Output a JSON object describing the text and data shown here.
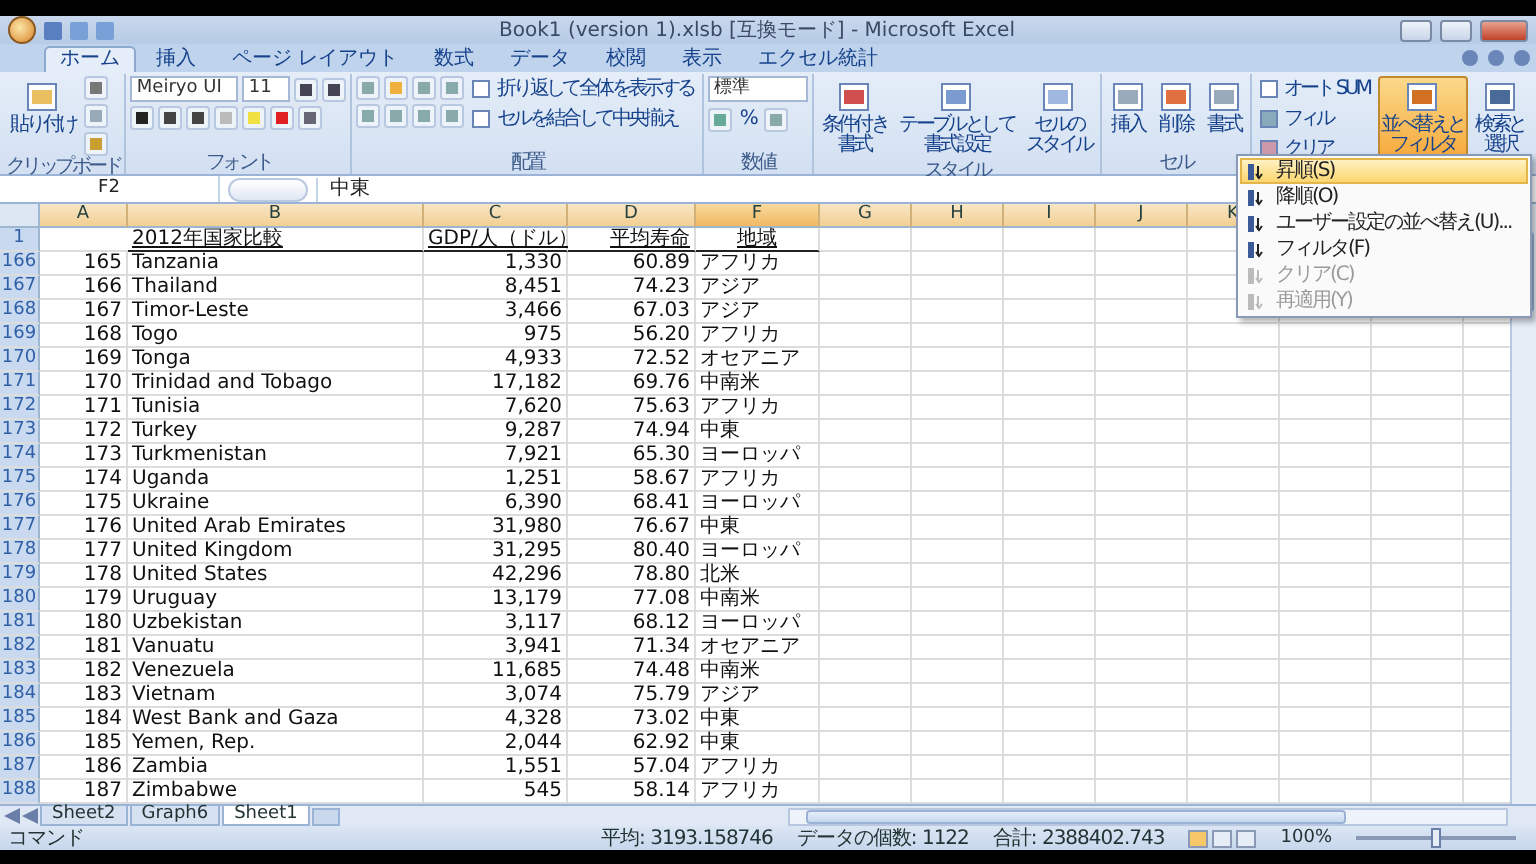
{
  "window": {
    "title": "Book1 (version 1).xlsb [互換モード] - Microsoft Excel"
  },
  "tabs": [
    {
      "label": "ホーム",
      "selected": true
    },
    {
      "label": "挿入",
      "selected": false
    },
    {
      "label": "ページ レイアウト",
      "selected": false
    },
    {
      "label": "数式",
      "selected": false
    },
    {
      "label": "データ",
      "selected": false
    },
    {
      "label": "校閲",
      "selected": false
    },
    {
      "label": "表示",
      "selected": false
    },
    {
      "label": "エクセル統計",
      "selected": false
    }
  ],
  "clipboard": {
    "label": "クリップボード",
    "paste": "貼り付け"
  },
  "font": {
    "label": "フォント",
    "name": "Meiryo UI",
    "size": "11"
  },
  "alignment": {
    "label": "配置",
    "wrap": "折り返して全体を表示する",
    "merge": "セルを結合して中央揃え"
  },
  "number": {
    "label": "数値",
    "format": "標準",
    "percent": "%"
  },
  "styles": {
    "label": "スタイル",
    "buttons": [
      [
        "条件付き",
        "書式"
      ],
      [
        "テーブルとして",
        "書式設定"
      ],
      [
        "セルの",
        "スタイル"
      ]
    ]
  },
  "cells": {
    "label": "セル",
    "buttons": [
      "挿入",
      "削除",
      "書式"
    ]
  },
  "editing": {
    "autosum": "オート SUM",
    "fill": "フィル",
    "clear": "クリア",
    "sort": {
      "lines": [
        "並べ替えと",
        "フィルタ"
      ],
      "pressed": true
    },
    "find": [
      "検索と",
      "選択"
    ]
  },
  "sort_menu": [
    {
      "label": "昇順(S)",
      "selected": true,
      "disabled": false
    },
    {
      "label": "降順(O)",
      "selected": false,
      "disabled": false
    },
    {
      "label": "ユーザー設定の並べ替え(U)...",
      "selected": false,
      "disabled": false
    },
    {
      "label": "フィルタ(F)",
      "selected": false,
      "disabled": false
    },
    {
      "label": "クリア(C)",
      "selected": false,
      "disabled": true
    },
    {
      "label": "再適用(Y)",
      "selected": false,
      "disabled": true
    }
  ],
  "formula_bar": {
    "name_box": "F2",
    "value": "中東"
  },
  "columns": [
    "A",
    "B",
    "C",
    "D",
    "F",
    "G",
    "H",
    "I",
    "J",
    "K"
  ],
  "header_row": {
    "row": "1",
    "b": "2012年国家比較",
    "c": "GDP/人（ドル）",
    "d": "平均寿命",
    "f": "地域"
  },
  "rows": [
    {
      "row": "166",
      "a": "165",
      "b": "Tanzania",
      "c": "1,330",
      "d": "60.89",
      "f": "アフリカ"
    },
    {
      "row": "167",
      "a": "166",
      "b": "Thailand",
      "c": "8,451",
      "d": "74.23",
      "f": "アジア"
    },
    {
      "row": "168",
      "a": "167",
      "b": "Timor-Leste",
      "c": "3,466",
      "d": "67.03",
      "f": "アジア"
    },
    {
      "row": "169",
      "a": "168",
      "b": "Togo",
      "c": "975",
      "d": "56.20",
      "f": "アフリカ"
    },
    {
      "row": "170",
      "a": "169",
      "b": "Tonga",
      "c": "4,933",
      "d": "72.52",
      "f": "オセアニア"
    },
    {
      "row": "171",
      "a": "170",
      "b": "Trinidad and Tobago",
      "c": "17,182",
      "d": "69.76",
      "f": "中南米"
    },
    {
      "row": "172",
      "a": "171",
      "b": "Tunisia",
      "c": "7,620",
      "d": "75.63",
      "f": "アフリカ"
    },
    {
      "row": "173",
      "a": "172",
      "b": "Turkey",
      "c": "9,287",
      "d": "74.94",
      "f": "中東"
    },
    {
      "row": "174",
      "a": "173",
      "b": "Turkmenistan",
      "c": "7,921",
      "d": "65.30",
      "f": "ヨーロッパ"
    },
    {
      "row": "175",
      "a": "174",
      "b": "Uganda",
      "c": "1,251",
      "d": "58.67",
      "f": "アフリカ"
    },
    {
      "row": "176",
      "a": "175",
      "b": "Ukraine",
      "c": "6,390",
      "d": "68.41",
      "f": "ヨーロッパ"
    },
    {
      "row": "177",
      "a": "176",
      "b": "United Arab Emirates",
      "c": "31,980",
      "d": "76.67",
      "f": "中東"
    },
    {
      "row": "178",
      "a": "177",
      "b": "United Kingdom",
      "c": "31,295",
      "d": "80.40",
      "f": "ヨーロッパ"
    },
    {
      "row": "179",
      "a": "178",
      "b": "United States",
      "c": "42,296",
      "d": "78.80",
      "f": "北米"
    },
    {
      "row": "180",
      "a": "179",
      "b": "Uruguay",
      "c": "13,179",
      "d": "77.08",
      "f": "中南米"
    },
    {
      "row": "181",
      "a": "180",
      "b": "Uzbekistan",
      "c": "3,117",
      "d": "68.12",
      "f": "ヨーロッパ"
    },
    {
      "row": "182",
      "a": "181",
      "b": "Vanuatu",
      "c": "3,941",
      "d": "71.34",
      "f": "オセアニア"
    },
    {
      "row": "183",
      "a": "182",
      "b": "Venezuela",
      "c": "11,685",
      "d": "74.48",
      "f": "中南米"
    },
    {
      "row": "184",
      "a": "183",
      "b": "Vietnam",
      "c": "3,074",
      "d": "75.79",
      "f": "アジア"
    },
    {
      "row": "185",
      "a": "184",
      "b": "West Bank and Gaza",
      "c": "4,328",
      "d": "73.02",
      "f": "中東"
    },
    {
      "row": "186",
      "a": "185",
      "b": "Yemen, Rep.",
      "c": "2,044",
      "d": "62.92",
      "f": "中東"
    },
    {
      "row": "187",
      "a": "186",
      "b": "Zambia",
      "c": "1,551",
      "d": "57.04",
      "f": "アフリカ"
    },
    {
      "row": "188",
      "a": "187",
      "b": "Zimbabwe",
      "c": "545",
      "d": "58.14",
      "f": "アフリカ"
    }
  ],
  "sheet_tabs": [
    {
      "label": "Sheet2",
      "selected": false
    },
    {
      "label": "Graph6",
      "selected": false
    },
    {
      "label": "Sheet1",
      "selected": true
    }
  ],
  "status_bar": {
    "mode": "コマンド",
    "average": "平均: 3193.158746",
    "count": "データの個数: 1122",
    "sum": "合計: 2388402.743",
    "zoom": "100%",
    "zoom_slider": {
      "level": 0.5
    }
  }
}
